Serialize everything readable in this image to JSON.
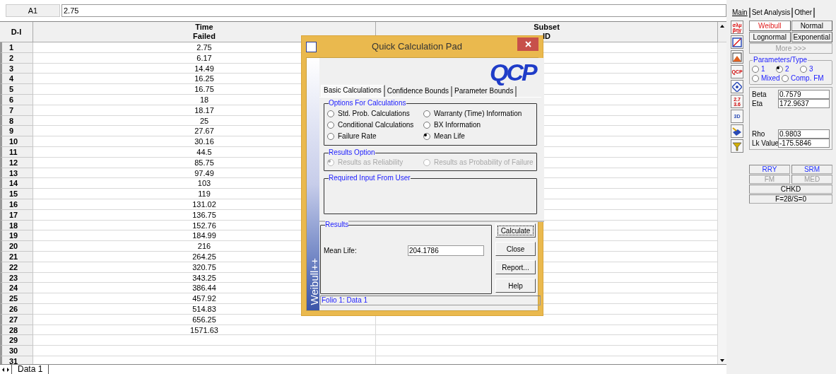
{
  "cell_ref": "A1",
  "formula": "2.75",
  "table": {
    "columns": [
      {
        "lines": [
          "D-I"
        ]
      },
      {
        "lines": [
          "Time",
          "Failed"
        ]
      },
      {
        "lines": [
          "Subset",
          "ID"
        ]
      }
    ],
    "rows": [
      {
        "id": "1",
        "time": "2.75"
      },
      {
        "id": "2",
        "time": "6.17"
      },
      {
        "id": "3",
        "time": "14.49"
      },
      {
        "id": "4",
        "time": "16.25"
      },
      {
        "id": "5",
        "time": "16.75"
      },
      {
        "id": "6",
        "time": "18"
      },
      {
        "id": "7",
        "time": "18.17"
      },
      {
        "id": "8",
        "time": "25"
      },
      {
        "id": "9",
        "time": "27.67"
      },
      {
        "id": "10",
        "time": "30.16"
      },
      {
        "id": "11",
        "time": "44.5"
      },
      {
        "id": "12",
        "time": "85.75"
      },
      {
        "id": "13",
        "time": "97.49"
      },
      {
        "id": "14",
        "time": "103"
      },
      {
        "id": "15",
        "time": "119"
      },
      {
        "id": "16",
        "time": "131.02"
      },
      {
        "id": "17",
        "time": "136.75"
      },
      {
        "id": "18",
        "time": "152.76"
      },
      {
        "id": "19",
        "time": "184.99"
      },
      {
        "id": "20",
        "time": "216"
      },
      {
        "id": "21",
        "time": "264.25"
      },
      {
        "id": "22",
        "time": "320.75"
      },
      {
        "id": "23",
        "time": "343.25"
      },
      {
        "id": "24",
        "time": "386.44"
      },
      {
        "id": "25",
        "time": "457.92"
      },
      {
        "id": "26",
        "time": "514.83"
      },
      {
        "id": "27",
        "time": "656.25"
      },
      {
        "id": "28",
        "time": "1571.63"
      },
      {
        "id": "29"
      },
      {
        "id": "30"
      },
      {
        "id": "31"
      }
    ]
  },
  "sheet_tabs": [
    {
      "label": "Data 1",
      "selected": true
    }
  ],
  "dialog": {
    "title": "Quick Calculation Pad",
    "logo_text": "QCP",
    "side_label": "Weibull++",
    "tabs": [
      {
        "label": "Basic Calculations",
        "selected": true
      },
      {
        "label": "Confidence Bounds",
        "selected": false
      },
      {
        "label": "Parameter Bounds",
        "selected": false
      }
    ],
    "options_group": {
      "title": "Options For Calculations",
      "options": [
        {
          "label": "Std. Prob. Calculations",
          "selected": false
        },
        {
          "label": "Warranty (Time) Information",
          "selected": false
        },
        {
          "label": "Conditional Calculations",
          "selected": false
        },
        {
          "label": "BX Information",
          "selected": false
        },
        {
          "label": "Failure Rate",
          "selected": false
        },
        {
          "label": "Mean Life",
          "selected": true
        }
      ]
    },
    "results_option": {
      "title": "Results Option",
      "disabled": true,
      "options": [
        {
          "label": "Results as Reliability",
          "selected": true
        },
        {
          "label": "Results as Probability of Failure",
          "selected": false
        }
      ]
    },
    "required_input": {
      "title": "Required Input From User"
    },
    "results": {
      "title": "Results",
      "fields": [
        {
          "label": "Mean Life:",
          "value": "204.1786"
        }
      ]
    },
    "buttons": [
      {
        "label": "Calculate",
        "focused": true
      },
      {
        "label": "Close",
        "focused": false
      },
      {
        "label": "Report...",
        "focused": false
      },
      {
        "label": "Help",
        "focused": false
      }
    ],
    "status": "Folio 1: Data 1"
  },
  "panel": {
    "tabs": [
      {
        "label": "Main",
        "selected": true
      },
      {
        "label": "Set Analysis",
        "selected": false
      },
      {
        "label": "Other",
        "selected": false
      }
    ],
    "toolbar": [
      {
        "kind": "symbols",
        "lines": [
          "σλμ",
          "βηγ"
        ]
      },
      {
        "kind": "plot"
      },
      {
        "kind": "chart"
      },
      {
        "kind": "qcp",
        "lines": [
          "QCP"
        ]
      },
      {
        "kind": "diamond"
      },
      {
        "kind": "numbers",
        "lines": [
          "2.7",
          "3.6"
        ]
      },
      {
        "kind": "three-d",
        "lines": [
          "3D"
        ]
      },
      {
        "kind": "book"
      },
      {
        "kind": "filter"
      }
    ],
    "distributions": [
      {
        "label": "Weibull",
        "selected": true
      },
      {
        "label": "Normal",
        "selected": false
      },
      {
        "label": "Lognormal",
        "selected": false
      },
      {
        "label": "Exponential",
        "selected": false
      }
    ],
    "more": {
      "label": "More >>>",
      "disabled": true
    },
    "parameters": {
      "title": "Parameters/Type",
      "options": [
        {
          "label": "1",
          "selected": false
        },
        {
          "label": "2",
          "selected": true
        },
        {
          "label": "3",
          "selected": false
        },
        {
          "label": "Mixed",
          "selected": false
        },
        {
          "label": "Comp. FM",
          "selected": false
        }
      ]
    },
    "fields_top": [
      {
        "label": "Beta",
        "value": "0.7579"
      },
      {
        "label": "Eta",
        "value": "172.9637"
      }
    ],
    "fields_bottom": [
      {
        "label": "Rho",
        "value": "0.9803"
      },
      {
        "label": "Lk Value",
        "value": "-175.5846"
      }
    ],
    "flags": [
      {
        "label": "RRY",
        "active": true
      },
      {
        "label": "SRM",
        "active": true
      },
      {
        "label": "FM",
        "active": false
      },
      {
        "label": "MED",
        "active": false
      }
    ],
    "summary": [
      {
        "label": "CHKD"
      },
      {
        "label": "F=28/S=0"
      }
    ]
  }
}
